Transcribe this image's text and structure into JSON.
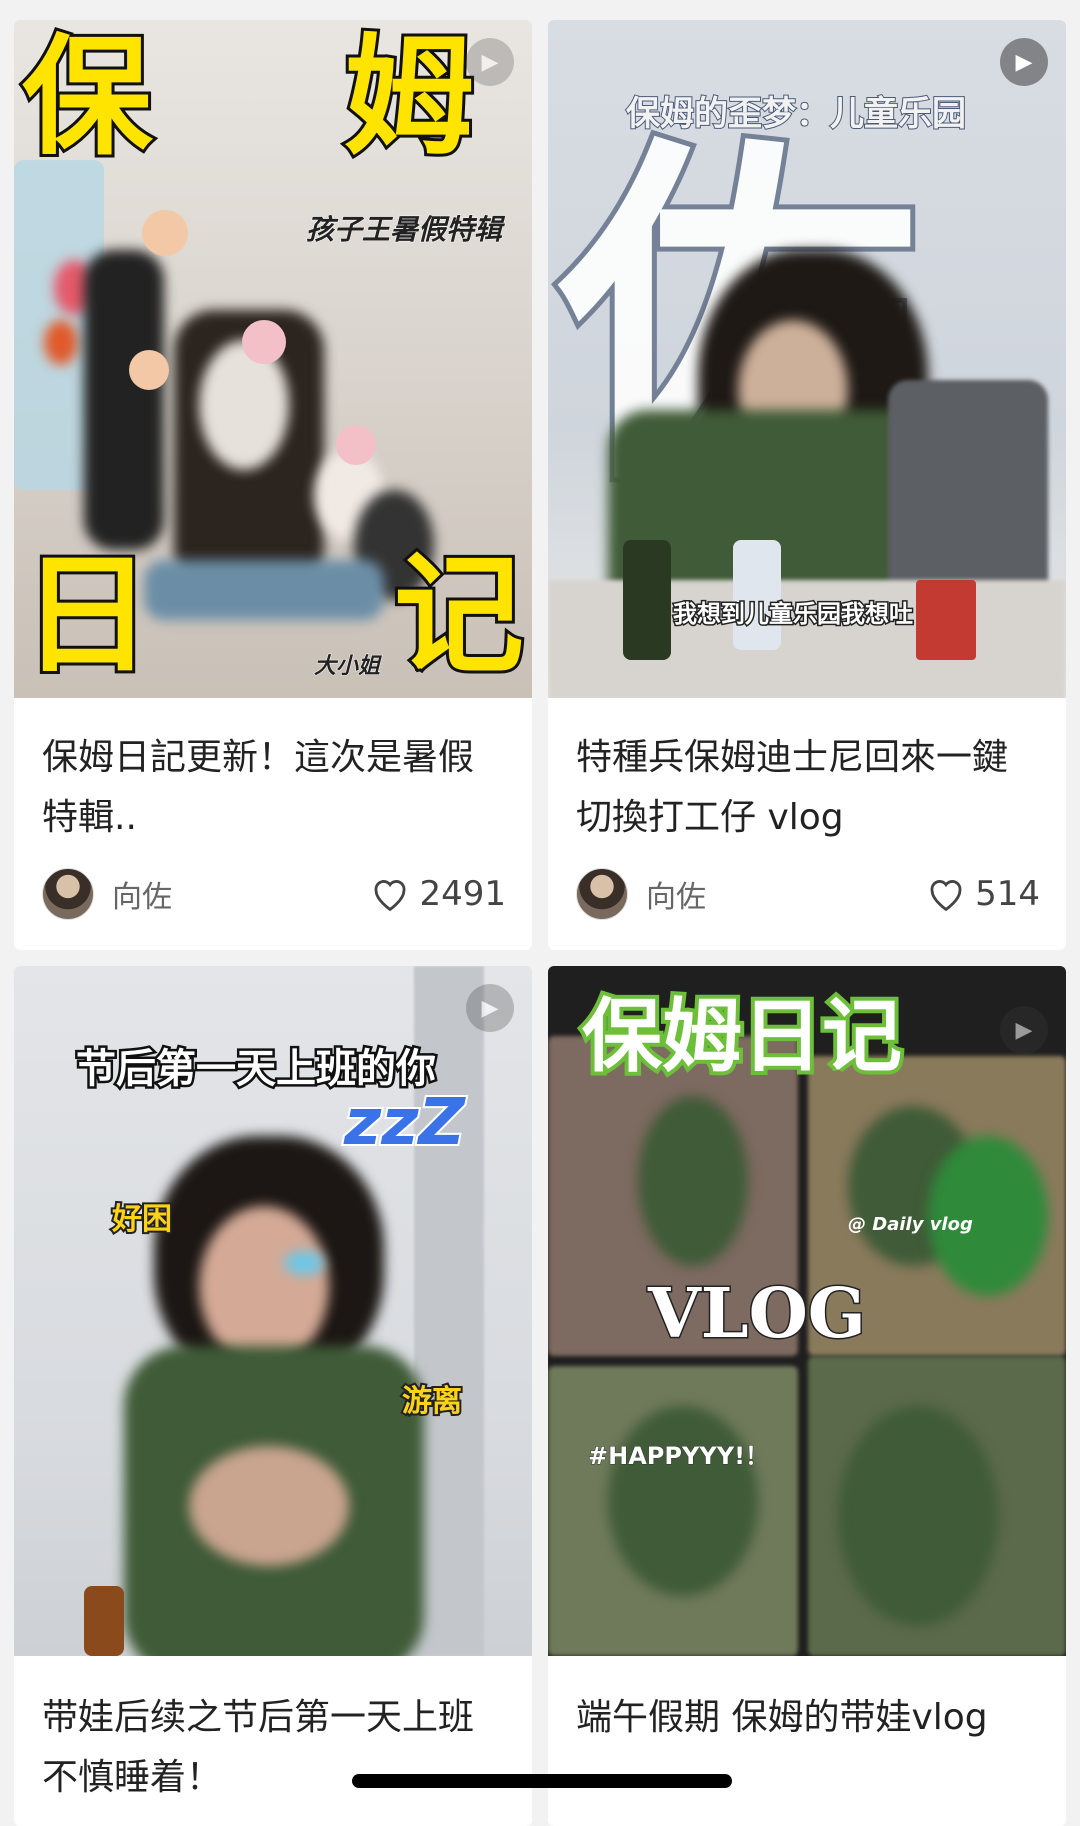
{
  "feed": {
    "cards": [
      {
        "thumb_text": {
          "big_1": "保",
          "big_2": "姆",
          "big_3": "日",
          "big_4": "记",
          "sub": "孩子王暑假特辑",
          "tag": "大小姐"
        },
        "title": "保姆日記更新！這次是暑假特輯..",
        "author": "向佐",
        "likes": "2491"
      },
      {
        "thumb_text": {
          "headline": "保姆的歪梦：儿童乐园",
          "bg_char": "佐",
          "subtitle": "我想到儿童乐园我想吐"
        },
        "title": "特種兵保姆迪士尼回來一鍵切換打工仔 vlog",
        "author": "向佐",
        "likes": "514"
      },
      {
        "thumb_text": {
          "headline": "节后第一天上班的你",
          "zzz": "zzZ",
          "tag_left": "好困",
          "tag_right": "游离"
        },
        "title": "带娃后续之节后第一天上班不慎睡着！"
      },
      {
        "thumb_text": {
          "headline": "保姆日记",
          "vlog": "VLOG",
          "hashtag": "#HAPPYYY!！",
          "daily": "@ Daily vlog"
        },
        "title": "端午假期 保姆的带娃vlog"
      }
    ]
  },
  "colors": {
    "accent_yellow": "#ffe400",
    "card_bg": "#ffffff",
    "page_bg": "#f2f2f2",
    "green_shirt": "#3f5b37"
  }
}
